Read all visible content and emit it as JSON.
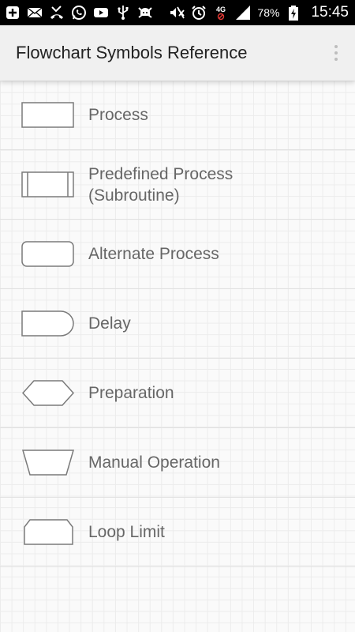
{
  "status_bar": {
    "left_icons": [
      "add-box-icon",
      "mail-icon",
      "missed-call-icon",
      "whatsapp-icon",
      "youtube-icon",
      "usb-icon",
      "android-debug-icon"
    ],
    "right_icons": [
      "mute-icon",
      "alarm-icon",
      "network-4g-icon",
      "signal-icon",
      "battery-charging-icon"
    ],
    "network_label": "4G",
    "battery_text": "78%",
    "time": "15:45"
  },
  "app_bar": {
    "title": "Flowchart Symbols Reference",
    "menu_icon": "more-vert-icon"
  },
  "symbols": [
    {
      "label": "Process",
      "icon": "process-symbol-icon"
    },
    {
      "label": "Predefined Process\n(Subroutine)",
      "icon": "predefined-process-symbol-icon"
    },
    {
      "label": "Alternate Process",
      "icon": "alternate-process-symbol-icon"
    },
    {
      "label": "Delay",
      "icon": "delay-symbol-icon"
    },
    {
      "label": "Preparation",
      "icon": "preparation-symbol-icon"
    },
    {
      "label": "Manual Operation",
      "icon": "manual-operation-symbol-icon"
    },
    {
      "label": "Loop Limit",
      "icon": "loop-limit-symbol-icon"
    }
  ],
  "colors": {
    "status_bar_bg": "#000000",
    "app_bar_bg": "#f0f0f0",
    "label_text": "#666666",
    "symbol_stroke": "#7a7a7a"
  }
}
